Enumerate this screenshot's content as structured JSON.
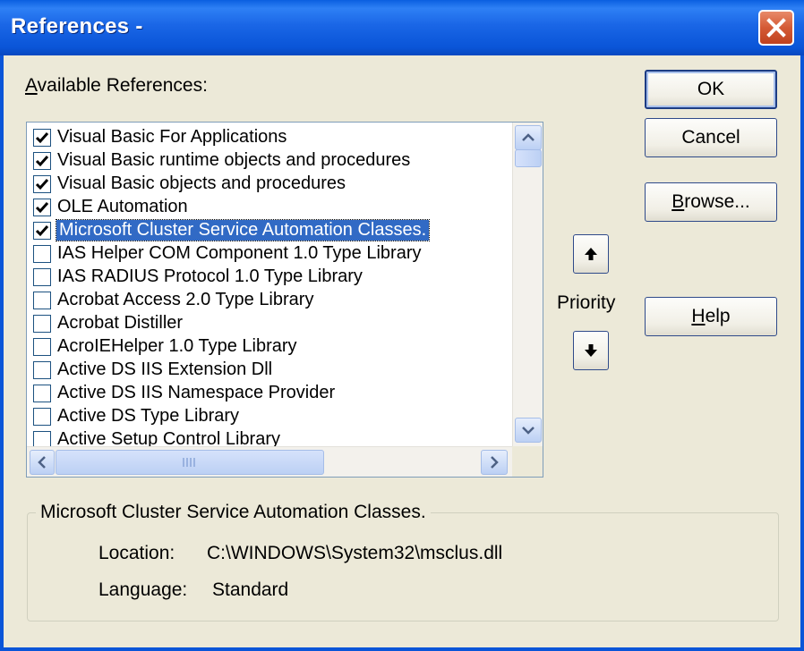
{
  "window": {
    "title": "References -"
  },
  "available": {
    "label_accel": "A",
    "label_rest": "vailable References:"
  },
  "references": [
    {
      "label": "Visual Basic For Applications",
      "checked": true
    },
    {
      "label": "Visual Basic runtime objects and procedures",
      "checked": true
    },
    {
      "label": "Visual Basic objects and procedures",
      "checked": true
    },
    {
      "label": "OLE Automation",
      "checked": true
    },
    {
      "label": "Microsoft Cluster Service Automation Classes.",
      "checked": true,
      "selected": true
    },
    {
      "label": " IAS Helper COM Component 1.0 Type Library",
      "checked": false
    },
    {
      "label": " IAS RADIUS Protocol 1.0 Type Library",
      "checked": false
    },
    {
      "label": "Acrobat Access 2.0 Type Library",
      "checked": false
    },
    {
      "label": "Acrobat Distiller",
      "checked": false
    },
    {
      "label": "AcroIEHelper 1.0 Type Library",
      "checked": false
    },
    {
      "label": "Active DS IIS Extension Dll",
      "checked": false
    },
    {
      "label": "Active DS IIS Namespace Provider",
      "checked": false
    },
    {
      "label": "Active DS Type Library",
      "checked": false
    },
    {
      "label": "Active Setup Control Library",
      "checked": false
    }
  ],
  "buttons": {
    "ok": "OK",
    "cancel": "Cancel",
    "browse_accel": "B",
    "browse_rest": "rowse...",
    "help_accel": "H",
    "help_rest": "elp"
  },
  "priority": {
    "label": "Priority"
  },
  "details": {
    "title": "Microsoft Cluster Service Automation Classes.",
    "location_label": "Location:",
    "location_value": "C:\\WINDOWS\\System32\\msclus.dll",
    "language_label": "Language:",
    "language_value": "Standard"
  },
  "colors": {
    "titlebar": "#0a55d8",
    "selection": "#316ac5",
    "face": "#ece9d8"
  }
}
